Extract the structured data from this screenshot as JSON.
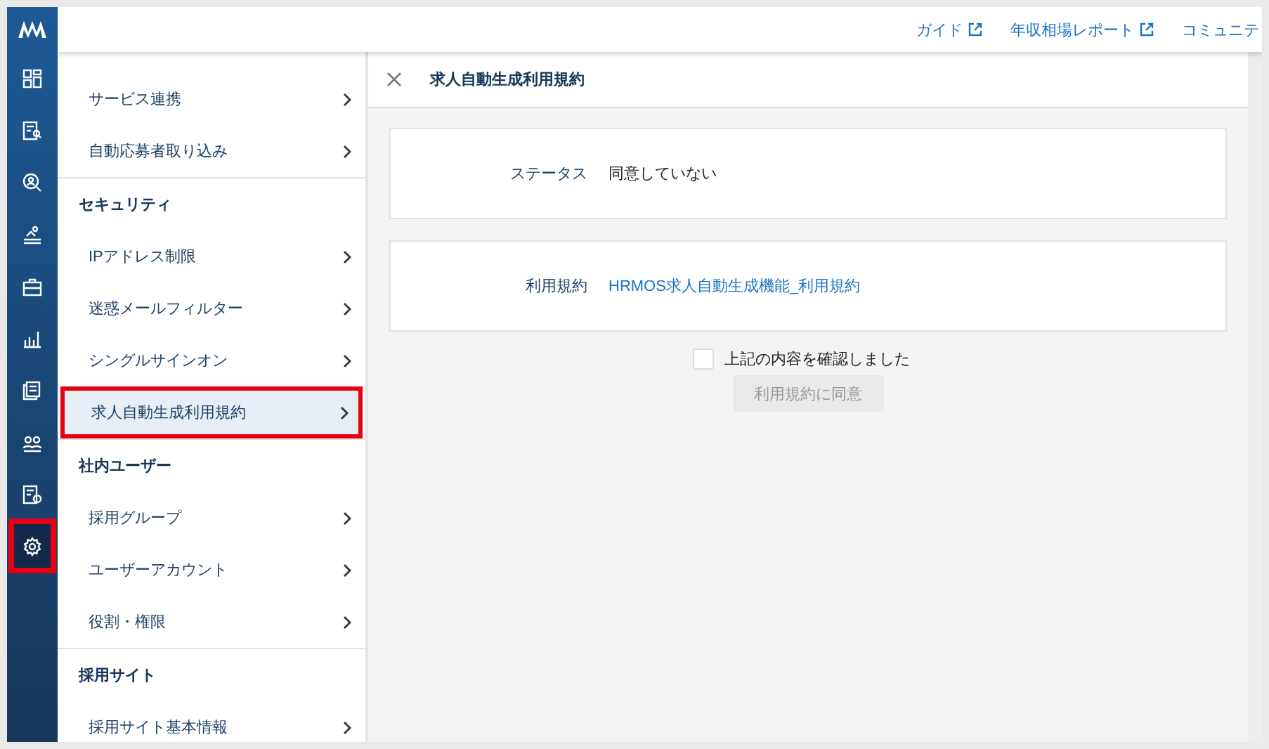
{
  "rail": {
    "items": [
      {
        "selected": false,
        "highlighted": false
      },
      {
        "selected": false,
        "highlighted": false
      },
      {
        "selected": false,
        "highlighted": false
      },
      {
        "selected": false,
        "highlighted": false
      },
      {
        "selected": false,
        "highlighted": false
      },
      {
        "selected": false,
        "highlighted": false
      },
      {
        "selected": false,
        "highlighted": false
      },
      {
        "selected": false,
        "highlighted": false
      },
      {
        "selected": false,
        "highlighted": false
      },
      {
        "selected": true,
        "highlighted": true
      }
    ]
  },
  "header": {
    "links": [
      {
        "label": "ガイド",
        "external": true
      },
      {
        "label": "年収相場レポート",
        "external": true
      },
      {
        "label": "コミュニテ",
        "external": false
      }
    ]
  },
  "menu": {
    "groups": [
      {
        "items": [
          {
            "label": "サービス連携",
            "selected": false,
            "highlighted": false
          },
          {
            "label": "自動応募者取り込み",
            "selected": false,
            "highlighted": false
          }
        ]
      },
      {
        "heading": "セキュリティ",
        "items": [
          {
            "label": "IPアドレス制限",
            "selected": false,
            "highlighted": false
          },
          {
            "label": "迷惑メールフィルター",
            "selected": false,
            "highlighted": false
          },
          {
            "label": "シングルサインオン",
            "selected": false,
            "highlighted": false
          },
          {
            "label": "求人自動生成利用規約",
            "selected": true,
            "highlighted": true
          }
        ]
      },
      {
        "heading": "社内ユーザー",
        "items": [
          {
            "label": "採用グループ",
            "selected": false,
            "highlighted": false
          },
          {
            "label": "ユーザーアカウント",
            "selected": false,
            "highlighted": false
          },
          {
            "label": "役割・権限",
            "selected": false,
            "highlighted": false
          }
        ]
      },
      {
        "heading": "採用サイト",
        "items": [
          {
            "label": "採用サイト基本情報",
            "selected": false,
            "highlighted": false
          }
        ]
      }
    ]
  },
  "detail": {
    "title": "求人自動生成利用規約",
    "fields": [
      {
        "label": "ステータス",
        "value": "同意していない",
        "kind": "text"
      },
      {
        "label": "利用規約",
        "value": "HRMOS求人自動生成機能_利用規約",
        "kind": "link"
      }
    ],
    "checkbox": {
      "label": "上記の内容を確認しました",
      "checked": false
    },
    "button": {
      "label": "利用規約に同意",
      "disabled": true
    }
  }
}
